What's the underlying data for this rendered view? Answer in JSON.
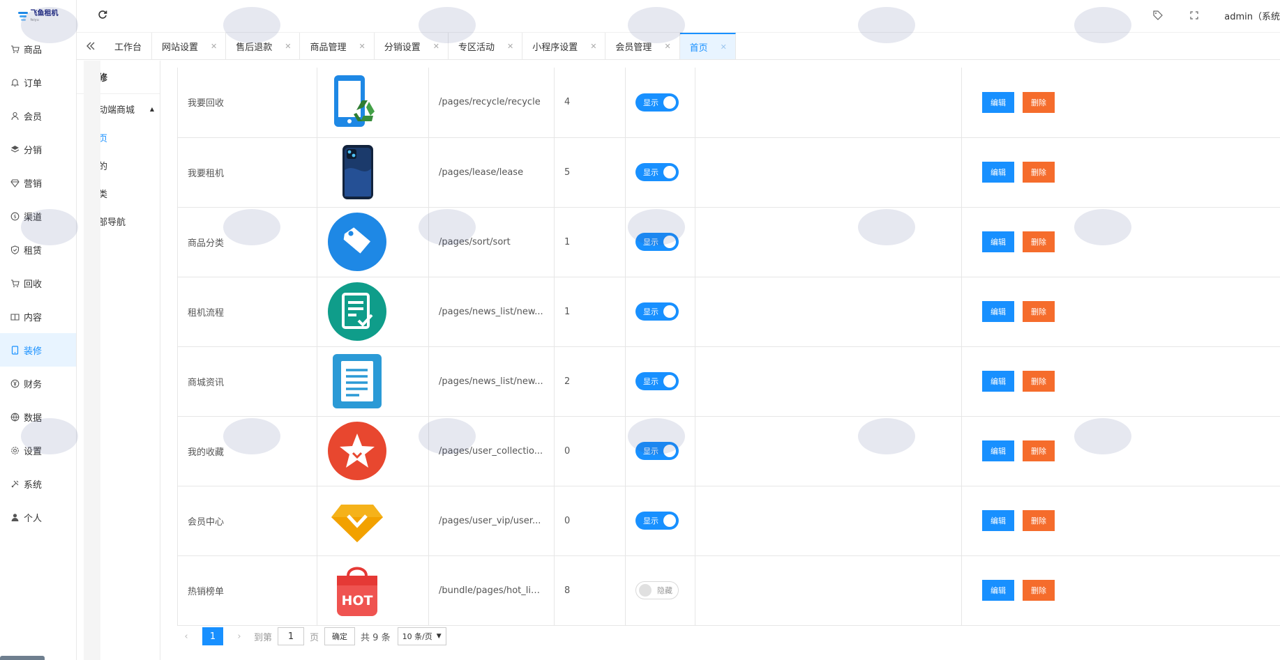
{
  "brand": {
    "logo_title": "飞鱼租机",
    "logo_subtitle": "feiyu"
  },
  "sidebar": {
    "items": [
      {
        "label": "商品",
        "icon": "cart-icon",
        "active": false
      },
      {
        "label": "订单",
        "icon": "bell-icon",
        "active": false
      },
      {
        "label": "会员",
        "icon": "user-icon",
        "active": false
      },
      {
        "label": "分销",
        "icon": "layers-icon",
        "active": false
      },
      {
        "label": "营销",
        "icon": "diamond-icon",
        "active": false
      },
      {
        "label": "渠道",
        "icon": "coin-icon",
        "active": false
      },
      {
        "label": "租赁",
        "icon": "shield-icon",
        "active": false
      },
      {
        "label": "回收",
        "icon": "cart-icon",
        "active": false
      },
      {
        "label": "内容",
        "icon": "book-icon",
        "active": false
      },
      {
        "label": "装修",
        "icon": "tablet-icon",
        "active": true
      },
      {
        "label": "财务",
        "icon": "yen-icon",
        "active": false
      },
      {
        "label": "数据",
        "icon": "globe-icon",
        "active": false
      },
      {
        "label": "设置",
        "icon": "gear-icon",
        "active": false
      },
      {
        "label": "系统",
        "icon": "tools-icon",
        "active": false
      },
      {
        "label": "个人",
        "icon": "person-icon",
        "active": false
      }
    ]
  },
  "header": {
    "admin_label": "admin（系统"
  },
  "tabs": [
    {
      "label": "工作台",
      "closable": false,
      "active": false
    },
    {
      "label": "网站设置",
      "closable": true,
      "active": false
    },
    {
      "label": "售后退款",
      "closable": true,
      "active": false
    },
    {
      "label": "商品管理",
      "closable": true,
      "active": false
    },
    {
      "label": "分销设置",
      "closable": true,
      "active": false
    },
    {
      "label": "专区活动",
      "closable": true,
      "active": false
    },
    {
      "label": "小程序设置",
      "closable": true,
      "active": false
    },
    {
      "label": "会员管理",
      "closable": true,
      "active": false
    },
    {
      "label": "首页",
      "closable": true,
      "active": true
    }
  ],
  "subnav": {
    "title": "装修",
    "group_label": "移动端商城",
    "items": [
      {
        "label": "首页",
        "active": true
      },
      {
        "label": "我的",
        "active": false
      },
      {
        "label": "分类",
        "active": false
      },
      {
        "label": "底部导航",
        "active": false
      }
    ]
  },
  "table": {
    "rows": [
      {
        "name": "我要回收",
        "icon": "phone-recycle-icon",
        "path": "/pages/recycle/recycle",
        "sort": "4",
        "status_label": "显示",
        "visible": true
      },
      {
        "name": "我要租机",
        "icon": "smartphone-icon",
        "path": "/pages/lease/lease",
        "sort": "5",
        "status_label": "显示",
        "visible": true
      },
      {
        "name": "商品分类",
        "icon": "tag-icon",
        "path": "/pages/sort/sort",
        "sort": "1",
        "status_label": "显示",
        "visible": true
      },
      {
        "name": "租机流程",
        "icon": "checklist-icon",
        "path": "/pages/news_list/new...",
        "sort": "1",
        "status_label": "显示",
        "visible": true
      },
      {
        "name": "商城资讯",
        "icon": "document-icon",
        "path": "/pages/news_list/new...",
        "sort": "2",
        "status_label": "显示",
        "visible": true
      },
      {
        "name": "我的收藏",
        "icon": "star-icon",
        "path": "/pages/user_collectio...",
        "sort": "0",
        "status_label": "显示",
        "visible": true
      },
      {
        "name": "会员中心",
        "icon": "vip-diamond-icon",
        "path": "/pages/user_vip/user...",
        "sort": "0",
        "status_label": "显示",
        "visible": true
      },
      {
        "name": "热销榜单",
        "icon": "hot-bag-icon",
        "path": "/bundle/pages/hot_lis...",
        "sort": "8",
        "status_label": "隐藏",
        "visible": false
      }
    ],
    "edit_label": "编辑",
    "delete_label": "删除"
  },
  "pager": {
    "current_page": "1",
    "goto_label": "到第",
    "page_input": "1",
    "page_unit": "页",
    "confirm_label": "确定",
    "total_label": "共 9 条",
    "page_size_label": "10 条/页"
  },
  "colors": {
    "primary": "#1890ff",
    "danger": "#f56c2c"
  }
}
